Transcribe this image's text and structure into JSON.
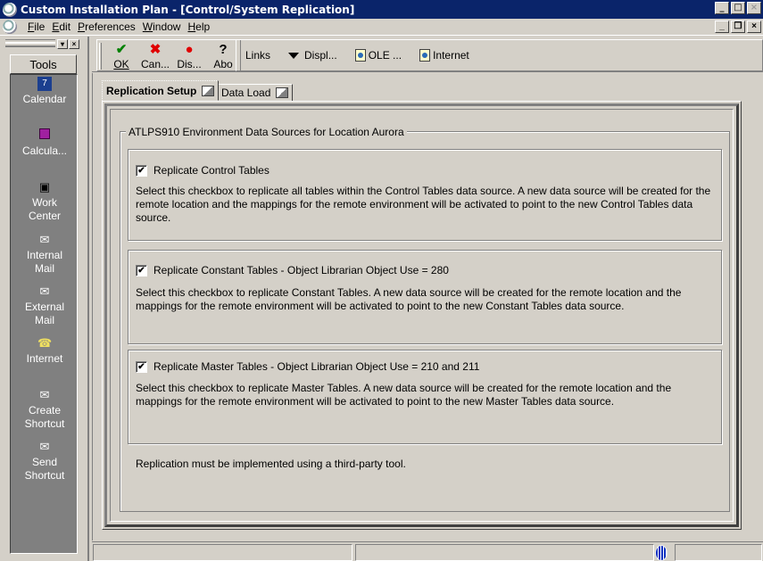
{
  "window": {
    "title": "Custom Installation Plan - [Control/System Replication]",
    "buttons": {
      "minimize": "_",
      "maximize": "□",
      "close": "×"
    }
  },
  "menubar": {
    "items": [
      {
        "label": "File",
        "accel": "F",
        "rest": "ile"
      },
      {
        "label": "Edit",
        "accel": "E",
        "rest": "dit"
      },
      {
        "label": "Preferences",
        "accel": "P",
        "rest": "references"
      },
      {
        "label": "Window",
        "accel": "W",
        "rest": "indow"
      },
      {
        "label": "Help",
        "accel": "H",
        "rest": "elp"
      }
    ]
  },
  "sidebar": {
    "title": "Tools",
    "items": [
      {
        "label": "Calendar",
        "icon": "calendar-icon"
      },
      {
        "label": "Calcula...",
        "icon": "calculator-icon"
      },
      {
        "label": "Work Center",
        "icon": "work-center-icon"
      },
      {
        "label": "Internal Mail",
        "icon": "mail-icon"
      },
      {
        "label": "External Mail",
        "icon": "mail-icon"
      },
      {
        "label": "Internet",
        "icon": "phone-icon"
      },
      {
        "label": "Create Shortcut",
        "icon": "shortcut-icon"
      },
      {
        "label": "Send Shortcut",
        "icon": "shortcut-icon"
      }
    ]
  },
  "toolbar": {
    "buttons": [
      {
        "label": "OK",
        "icon": "checkmark-icon",
        "glyph": "✔",
        "color": "#008000"
      },
      {
        "label": "Can...",
        "icon": "cancel-icon",
        "glyph": "✖",
        "color": "#e00000"
      },
      {
        "label": "Dis...",
        "icon": "display-icon",
        "glyph": "●",
        "color": "#e00000"
      },
      {
        "label": "Abo",
        "icon": "about-icon",
        "glyph": "?",
        "color": "#000000"
      }
    ],
    "links_label": "Links",
    "display_label": "Displ...",
    "ole_label": "OLE ...",
    "internet_label": "Internet"
  },
  "tabs": [
    {
      "label": "Replication Setup",
      "active": true
    },
    {
      "label": "Data Load",
      "active": false
    }
  ],
  "group": {
    "title": "ATLPS910 Environment Data Sources for Location Aurora",
    "sections": [
      {
        "checkbox_label": "Replicate Control Tables",
        "checked": true,
        "description": "Select this checkbox to replicate all tables within the Control Tables data source. A new data source will be created for the remote location and the mappings for the remote environment will be activated to point to the new Control Tables data source."
      },
      {
        "checkbox_label": "Replicate Constant Tables - Object Librarian Object Use = 280",
        "checked": true,
        "description": "Select this checkbox to replicate Constant Tables. A new data source will be created for the remote location and the mappings for the remote environment will be activated to point to the new Constant Tables data source."
      },
      {
        "checkbox_label": "Replicate Master Tables - Object Librarian Object Use = 210 and 211",
        "checked": true,
        "description": "Select this checkbox to replicate Master Tables. A new data source will be created for the remote location and the mappings for the remote environment will be activated to point to the new Master Tables data source."
      }
    ],
    "footnote": "Replication must be implemented using a third-party tool."
  },
  "check_glyph": "✔"
}
